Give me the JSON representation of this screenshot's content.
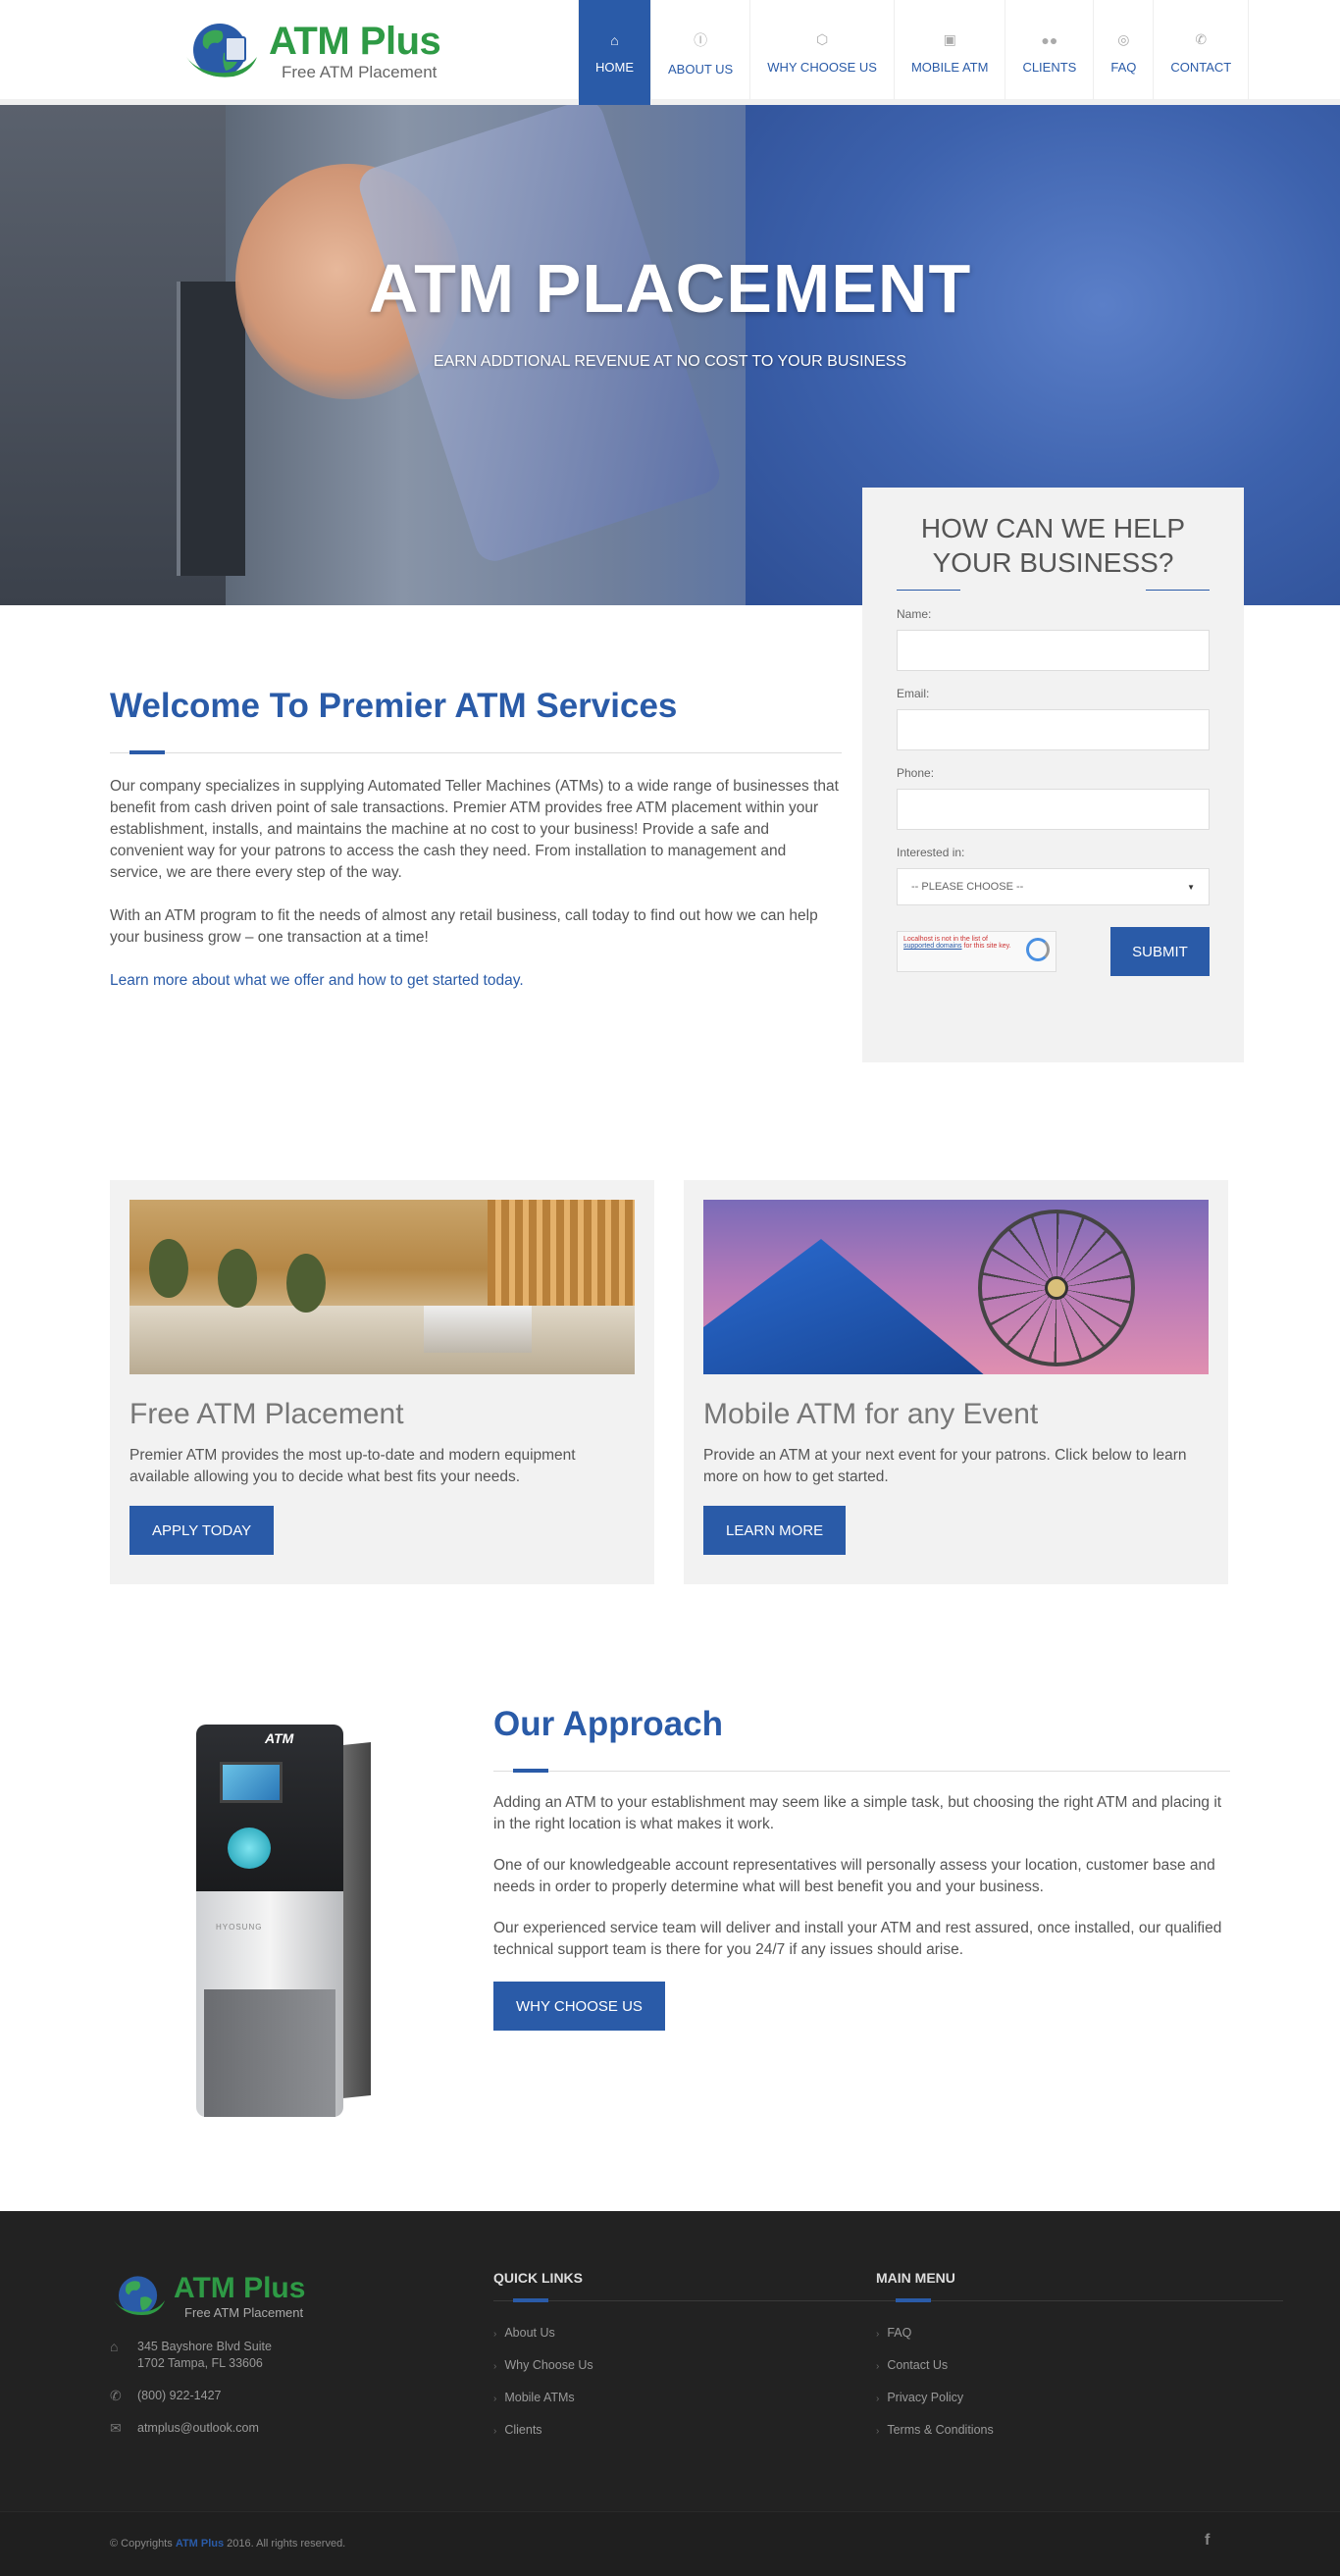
{
  "header": {
    "logo_brand": "ATM Plus",
    "logo_tagline": "Free ATM Placement",
    "nav": [
      {
        "label": "HOME",
        "icon": "home-icon",
        "active": true
      },
      {
        "label": "ABOUT US",
        "icon": "info-icon"
      },
      {
        "label": "WHY CHOOSE US",
        "icon": "cube-icon"
      },
      {
        "label": "MOBILE ATM",
        "icon": "money-icon"
      },
      {
        "label": "CLIENTS",
        "icon": "users-icon"
      },
      {
        "label": "FAQ",
        "icon": "lifebuoy-icon"
      },
      {
        "label": "CONTACT",
        "icon": "phone-icon"
      }
    ]
  },
  "hero": {
    "title": "ATM PLACEMENT",
    "subtitle": "EARN ADDTIONAL REVENUE AT NO COST TO YOUR BUSINESS"
  },
  "form": {
    "title": "HOW CAN WE HELP YOUR BUSINESS?",
    "name_label": "Name:",
    "email_label": "Email:",
    "phone_label": "Phone:",
    "interest_label": "Interested in:",
    "interest_selected": "-- PLEASE CHOOSE --",
    "captcha_text": "Localhost is not in the list of",
    "captcha_link": "supported domains",
    "captcha_text2": "for this site key.",
    "submit_label": "SUBMIT"
  },
  "welcome": {
    "title": "Welcome To Premier ATM Services",
    "para1": "Our company specializes in supplying Automated Teller Machines (ATMs) to a wide range of businesses that benefit from cash driven point of sale transactions. Premier ATM provides free ATM placement within your establishment, installs, and maintains the machine at no cost to your business! Provide a safe and convenient way for your patrons to access the cash they need. From installation to management and service, we are there every step of the way.",
    "para2": "With an ATM program to fit the needs of almost any retail business, call today to find out how we can help your business grow – one transaction at a time!",
    "link": "Learn more about what we offer and how to get started today."
  },
  "cards": [
    {
      "title": "Free ATM Placement",
      "text": "Premier ATM provides the most up-to-date and modern equipment available allowing you to decide what best fits your needs.",
      "button": "APPLY TODAY"
    },
    {
      "title": "Mobile ATM for any Event",
      "text": "Provide an ATM at your next event for your patrons. Click below to learn more on how to get started.",
      "button": "LEARN MORE"
    }
  ],
  "approach": {
    "atm_label": "ATM",
    "atm_brand": "HYOSUNG",
    "title": "Our Approach",
    "para1": "Adding an ATM to your establishment may seem like a simple task, but choosing the right ATM and placing it in the right location is what makes it work.",
    "para2": "One of our knowledgeable account representatives will personally assess your location, customer base and needs in order to properly determine what will best benefit you and your business.",
    "para3": "Our experienced service team will deliver and install your ATM and rest assured, once installed, our qualified technical support team is there for you 24/7 if any issues should arise.",
    "button": "WHY CHOOSE US"
  },
  "footer": {
    "logo_brand": "ATM Plus",
    "logo_tagline": "Free ATM Placement",
    "address_line1": "345 Bayshore Blvd Suite",
    "address_line2": "1702 Tampa, FL 33606",
    "phone": "(800) 922-1427",
    "email": "atmplus@outlook.com",
    "quick_links_title": "QUICK LINKS",
    "quick_links": [
      "About Us",
      "Why Choose Us",
      "Mobile ATMs",
      "Clients"
    ],
    "main_menu_title": "MAIN MENU",
    "main_menu": [
      "FAQ",
      "Contact Us",
      "Privacy Policy",
      "Terms & Conditions"
    ],
    "copyright_prefix": "© Copyrights",
    "copyright_brand": "ATM Plus",
    "copyright_suffix": "2016. All rights reserved.",
    "social_icon": "facebook-icon"
  },
  "colors": {
    "brand_blue": "#2a5ba8",
    "brand_green": "#2e9a45",
    "footer_bg": "#222222",
    "panel_bg": "#f2f2f2"
  }
}
